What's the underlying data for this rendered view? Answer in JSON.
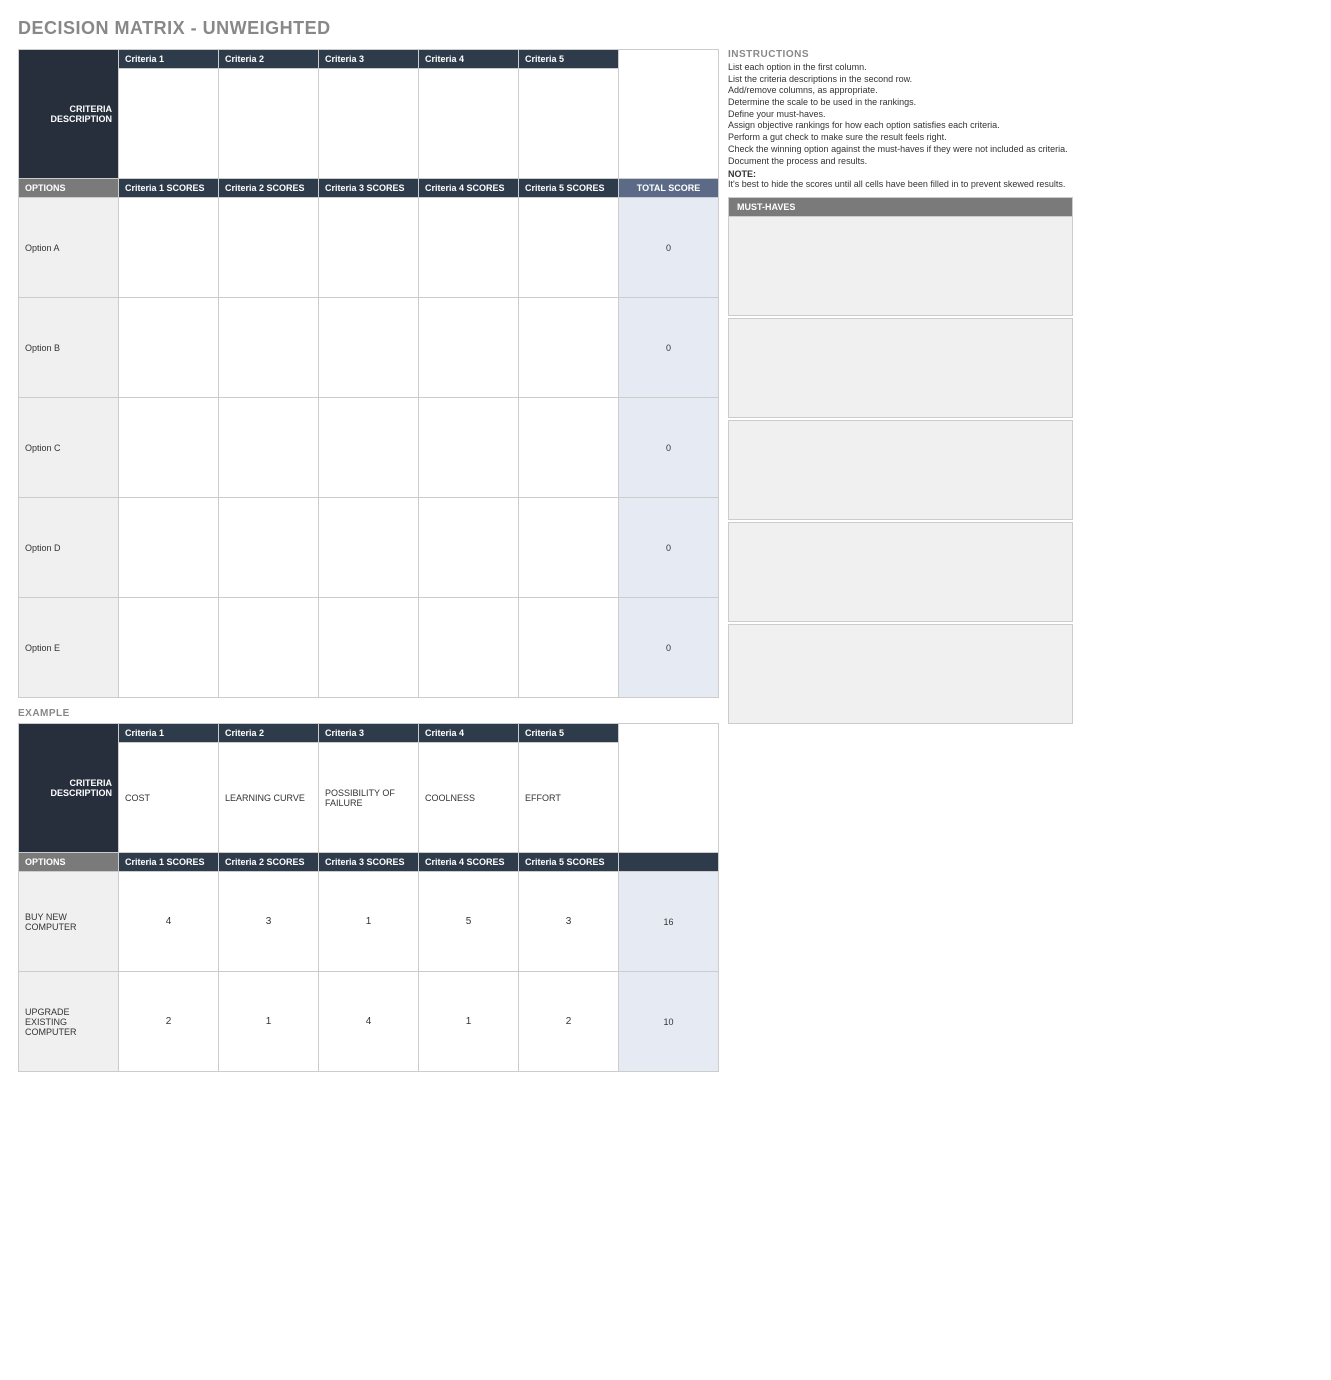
{
  "title": "DECISION MATRIX - UNWEIGHTED",
  "criteriaHeaders": [
    "Criteria 1",
    "Criteria 2",
    "Criteria 3",
    "Criteria 4",
    "Criteria 5"
  ],
  "criteriaDescLabel": "CRITERIA DESCRIPTION",
  "optionsLabel": "OPTIONS",
  "scoreHeaders": [
    "Criteria 1 SCORES",
    "Criteria 2 SCORES",
    "Criteria 3 SCORES",
    "Criteria 4 SCORES",
    "Criteria 5 SCORES"
  ],
  "totalScoreLabel": "TOTAL SCORE",
  "options": [
    {
      "name": "Option A",
      "total": "0"
    },
    {
      "name": "Option B",
      "total": "0"
    },
    {
      "name": "Option C",
      "total": "0"
    },
    {
      "name": "Option D",
      "total": "0"
    },
    {
      "name": "Option E",
      "total": "0"
    }
  ],
  "instructions": {
    "title": "INSTRUCTIONS",
    "lines": [
      "List each option in the first column.",
      "List the criteria descriptions in the second row.",
      "Add/remove columns, as appropriate.",
      "Determine the scale to be used in the rankings.",
      "Define your must-haves.",
      "Assign objective rankings for how each option satisfies each criteria.",
      "Perform a gut check to make sure the result feels right.",
      "Check the winning option against the must-haves if they were not included as criteria.",
      "Document the process and results."
    ],
    "noteLabel": "NOTE:",
    "noteText": "It's best to hide the scores until all cells have been filled in to prevent skewed results."
  },
  "mustHavesLabel": "MUST-HAVES",
  "mustHavesCount": 5,
  "exampleLabel": "EXAMPLE",
  "example": {
    "criteriaHeaders": [
      "Criteria 1",
      "Criteria 2",
      "Criteria 3",
      "Criteria 4",
      "Criteria 5"
    ],
    "criteriaDesc": [
      "COST",
      "LEARNING CURVE",
      "POSSIBILITY OF FAILURE",
      "COOLNESS",
      "EFFORT"
    ],
    "scoreHeaders": [
      "Criteria 1 SCORES",
      "Criteria 2 SCORES",
      "Criteria 3 SCORES",
      "Criteria 4 SCORES",
      "Criteria 5 SCORES"
    ],
    "rows": [
      {
        "name": "BUY NEW COMPUTER",
        "scores": [
          "4",
          "3",
          "1",
          "5",
          "3"
        ],
        "total": "16"
      },
      {
        "name": "UPGRADE EXISTING COMPUTER",
        "scores": [
          "2",
          "1",
          "4",
          "1",
          "2"
        ],
        "total": "10"
      }
    ]
  }
}
